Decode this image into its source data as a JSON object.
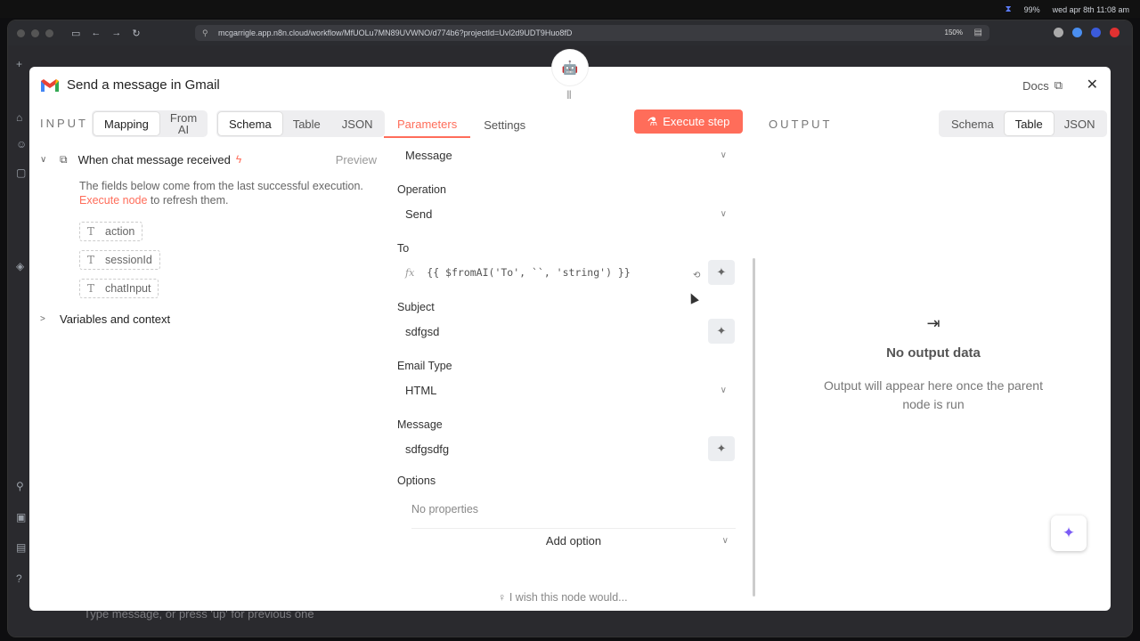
{
  "system": {
    "battery": "99%",
    "datetime": "wed apr 8th 11:08 am"
  },
  "browser": {
    "url": "mcgarrigle.app.n8n.cloud/workflow/MfUOLu7MN89UVWNO/d774b6?projectId=Uvl2d9UDT9Huo8fD",
    "zoom": "150%"
  },
  "background": {
    "chat_placeholder": "Type message, or press 'up' for previous one"
  },
  "modal": {
    "title": "Send a message in Gmail",
    "docs": "Docs",
    "input": {
      "label": "INPUT",
      "mode_options": [
        "Mapping",
        "From AI"
      ],
      "mode_active": "Mapping",
      "view_options": [
        "Schema",
        "Table",
        "JSON"
      ],
      "view_active": "Schema",
      "node_name": "When chat message received",
      "preview": "Preview",
      "hint_text": "The fields below come from the last successful execution.",
      "hint_link": "Execute node",
      "hint_suffix": " to refresh them.",
      "fields": [
        "action",
        "sessionId",
        "chatInput"
      ],
      "variables": "Variables and context"
    },
    "params": {
      "tabs": [
        "Parameters",
        "Settings"
      ],
      "active_tab": "Parameters",
      "execute": "Execute step",
      "resource_value": "Message",
      "operation_label": "Operation",
      "operation_value": "Send",
      "to_label": "To",
      "to_value": "{{ $fromAI('To', ``, 'string') }}",
      "subject_label": "Subject",
      "subject_value": "sdfgsd",
      "email_type_label": "Email Type",
      "email_type_value": "HTML",
      "message_label": "Message",
      "message_value": "sdfgsdfg",
      "options_label": "Options",
      "no_properties": "No properties",
      "add_option": "Add option",
      "wish": "I wish this node would..."
    },
    "output": {
      "label": "OUTPUT",
      "view_options": [
        "Schema",
        "Table",
        "JSON"
      ],
      "view_active": "Table",
      "empty_title": "No output data",
      "empty_text": "Output will appear here once the parent node is run"
    }
  }
}
